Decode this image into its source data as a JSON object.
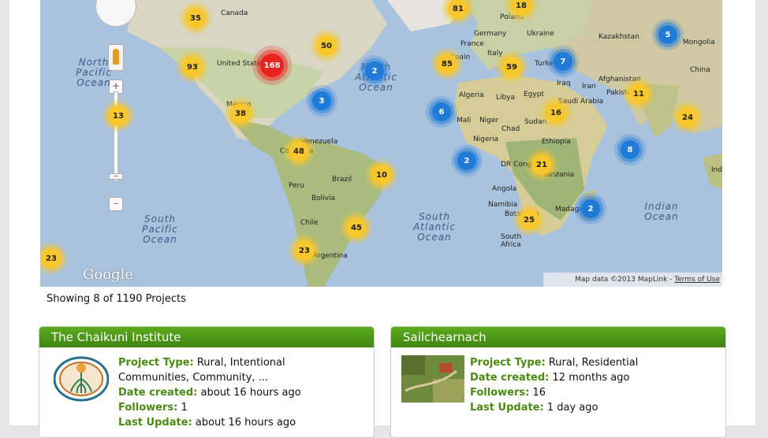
{
  "map": {
    "countries": [
      "Canada",
      "United States",
      "Mexico",
      "Venezuela",
      "Colombia",
      "Peru",
      "Brazil",
      "Bolivia",
      "Chile",
      "Argentina",
      "Poland",
      "Germany",
      "France",
      "Spain",
      "Italy",
      "Ukraine",
      "Kazakhstan",
      "Mongolia",
      "China",
      "Turkey",
      "Iraq",
      "Iran",
      "Afghanistan",
      "Pakistan",
      "Algeria",
      "Libya",
      "Egypt",
      "Saudi Arabia",
      "Mali",
      "Niger",
      "Chad",
      "Sudan",
      "Nigeria",
      "Ethiopia",
      "DR Congo",
      "Tanzania",
      "Angola",
      "Namibia",
      "Botswana",
      "South Africa",
      "Madagascar",
      "India"
    ],
    "oceans": [
      "North Pacific Ocean",
      "North Atlantic Ocean",
      "South Pacific Ocean",
      "South Atlantic Ocean",
      "Indian Ocean"
    ],
    "clusters": [
      {
        "count": "35",
        "color": "y"
      },
      {
        "count": "93",
        "color": "y"
      },
      {
        "count": "168",
        "color": "r"
      },
      {
        "count": "50",
        "color": "y"
      },
      {
        "count": "13",
        "color": "y"
      },
      {
        "count": "38",
        "color": "y"
      },
      {
        "count": "3",
        "color": "b"
      },
      {
        "count": "2",
        "color": "b"
      },
      {
        "count": "48",
        "color": "y"
      },
      {
        "count": "10",
        "color": "y"
      },
      {
        "count": "45",
        "color": "y"
      },
      {
        "count": "23",
        "color": "y"
      },
      {
        "count": "23",
        "color": "y"
      },
      {
        "count": "81",
        "color": "y"
      },
      {
        "count": "18",
        "color": "y"
      },
      {
        "count": "85",
        "color": "y"
      },
      {
        "count": "59",
        "color": "y"
      },
      {
        "count": "7",
        "color": "b"
      },
      {
        "count": "5",
        "color": "b"
      },
      {
        "count": "6",
        "color": "b"
      },
      {
        "count": "16",
        "color": "y"
      },
      {
        "count": "11",
        "color": "y"
      },
      {
        "count": "24",
        "color": "y"
      },
      {
        "count": "8",
        "color": "b"
      },
      {
        "count": "2",
        "color": "b"
      },
      {
        "count": "21",
        "color": "y"
      },
      {
        "count": "25",
        "color": "y"
      },
      {
        "count": "2",
        "color": "b"
      }
    ],
    "logo": "Google",
    "attribution": "Map data ©2013 MapLink - ",
    "terms": "Terms of Use"
  },
  "showing": "Showing 8 of 1190 Projects",
  "cards": [
    {
      "title": "The Chaikuni Institute",
      "type_label": "Project Type:",
      "type_value": "Rural, Intentional Communities, Community, ...",
      "date_label": "Date created:",
      "date_value": "about 16 hours ago",
      "followers_label": "Followers:",
      "followers_value": "1",
      "update_label": "Last Update:",
      "update_value": "about 16 hours ago"
    },
    {
      "title": "Sailchearnach",
      "type_label": "Project Type:",
      "type_value": "Rural, Residential",
      "date_label": "Date created:",
      "date_value": "12 months ago",
      "followers_label": "Followers:",
      "followers_value": "16",
      "update_label": "Last Update:",
      "update_value": "1 day ago"
    }
  ]
}
